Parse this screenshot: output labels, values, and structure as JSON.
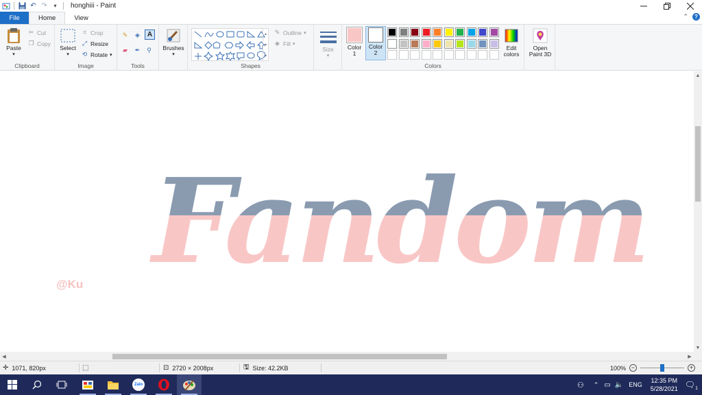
{
  "window": {
    "title": "honghiii - Paint",
    "minimize_icon": "minimize-icon",
    "restore_icon": "restore-icon",
    "close_icon": "close-icon"
  },
  "tabs": [
    "File",
    "Home",
    "View"
  ],
  "ribbon": {
    "clipboard": {
      "label": "Clipboard",
      "paste": "Paste",
      "cut": "Cut",
      "copy": "Copy"
    },
    "image": {
      "label": "Image",
      "select": "Select",
      "crop": "Crop",
      "resize": "Resize",
      "rotate": "Rotate"
    },
    "tools": {
      "label": "Tools"
    },
    "brushes": {
      "label": "Brushes"
    },
    "shapes": {
      "label": "Shapes",
      "outline": "Outline",
      "fill": "Fill",
      "size": "Size"
    },
    "colors": {
      "label": "Colors",
      "color1": "Color 1",
      "color1_line2": "1",
      "color2": "Color 2",
      "color2_line2": "2",
      "color1_value": "#f9c6c6",
      "color2_value": "#ffffff",
      "edit_colors": "Edit",
      "edit_colors_line2": "colors",
      "palette_row1": [
        "#000000",
        "#7f7f7f",
        "#880015",
        "#ed1c24",
        "#ff7f27",
        "#fff200",
        "#22b14c",
        "#00a2e8",
        "#3f48cc",
        "#a349a4"
      ],
      "palette_row2": [
        "#ffffff",
        "#c3c3c3",
        "#b97a57",
        "#ffaec9",
        "#ffc90e",
        "#efe4b0",
        "#b5e61d",
        "#99d9ea",
        "#7092be",
        "#c8bfe7"
      ]
    },
    "paint3d": {
      "label": "Open",
      "label_line2": "Paint 3D"
    }
  },
  "canvas": {
    "artwork_text": "Fandom",
    "watermark": "@Ku",
    "top_color": "#8a9bb0",
    "bottom_color": "#f9c6c6"
  },
  "status": {
    "cursor_pos": "1071, 820px",
    "image_size": "2720 × 2008px",
    "file_size": "Size: 42.2KB",
    "zoom": "100%"
  },
  "taskbar": {
    "time": "12:35 PM",
    "date": "5/28/2021",
    "lang": "ENG",
    "zalo": "Zalo"
  }
}
